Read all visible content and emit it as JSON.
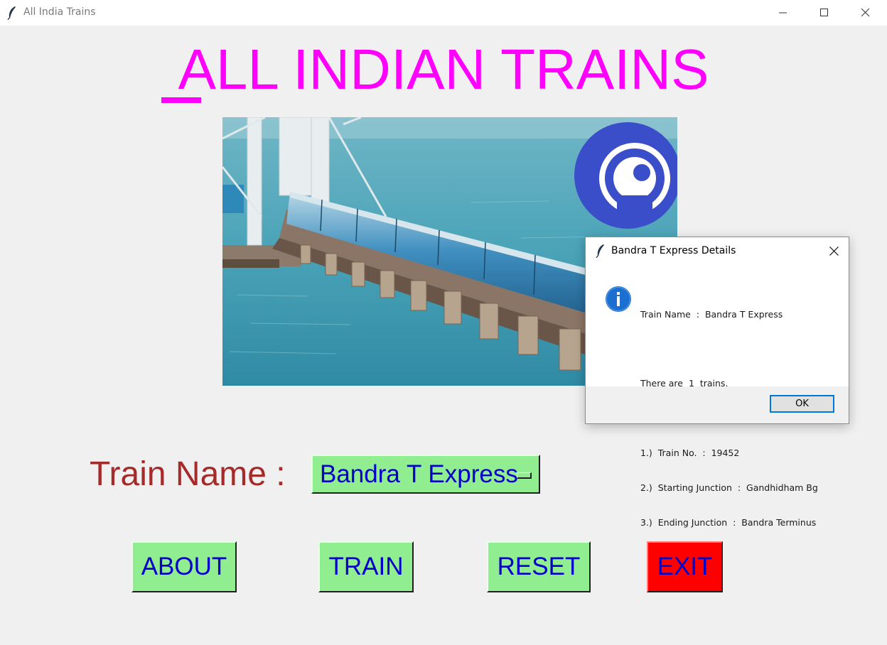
{
  "window": {
    "title": "All India Trains"
  },
  "main": {
    "heading": "ALL INDIAN TRAINS",
    "train_label": "Train Name :",
    "train_select_value": "Bandra T Express",
    "buttons": {
      "about": "ABOUT",
      "train": "TRAIN",
      "reset": "RESET",
      "exit": "EXIT"
    }
  },
  "dialog": {
    "title": "Bandra T Express Details",
    "message_lines": [
      "Train Name  :  Bandra T Express",
      "",
      "There are  1  trains.",
      "",
      "1.)  Train No.  :  19452",
      "2.)  Starting Junction  :  Gandhidham Bg",
      "3.)  Ending Junction  :  Bandra Terminus"
    ],
    "ok_label": "OK"
  },
  "colors": {
    "heading": "#ff00ff",
    "label": "#a52a2a",
    "button_bg": "#90ee90",
    "button_text": "#0000cd",
    "exit_bg": "#ff0000"
  },
  "icons": {
    "app": "feather-icon",
    "dialog_info": "info-icon"
  }
}
